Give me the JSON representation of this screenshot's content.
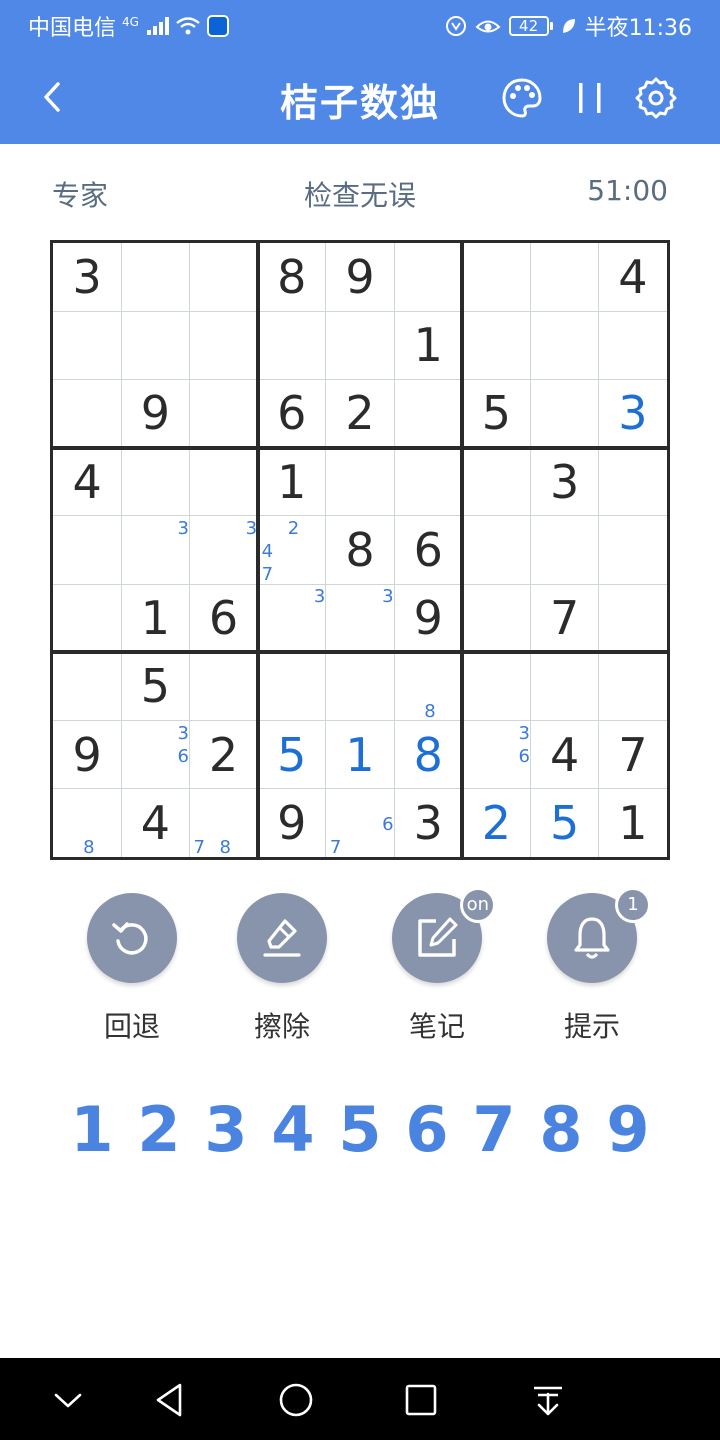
{
  "status_bar": {
    "carrier": "中国电信",
    "network": "4G",
    "battery": "42",
    "time": "半夜11:36"
  },
  "app_bar": {
    "title": "桔子数独",
    "icons": [
      "back-arrow-icon",
      "palette-icon",
      "pause-icon",
      "gear-icon"
    ]
  },
  "info": {
    "difficulty": "专家",
    "check_status": "检查无误",
    "timer": "51:00"
  },
  "board": {
    "cells": [
      {
        "r": 0,
        "c": 0,
        "v": "3",
        "t": "given"
      },
      {
        "r": 0,
        "c": 3,
        "v": "8",
        "t": "given"
      },
      {
        "r": 0,
        "c": 4,
        "v": "9",
        "t": "given"
      },
      {
        "r": 0,
        "c": 8,
        "v": "4",
        "t": "given"
      },
      {
        "r": 1,
        "c": 5,
        "v": "1",
        "t": "given"
      },
      {
        "r": 2,
        "c": 1,
        "v": "9",
        "t": "given"
      },
      {
        "r": 2,
        "c": 3,
        "v": "6",
        "t": "given"
      },
      {
        "r": 2,
        "c": 4,
        "v": "2",
        "t": "given"
      },
      {
        "r": 2,
        "c": 6,
        "v": "5",
        "t": "given"
      },
      {
        "r": 2,
        "c": 8,
        "v": "3",
        "t": "user"
      },
      {
        "r": 3,
        "c": 0,
        "v": "4",
        "t": "given"
      },
      {
        "r": 3,
        "c": 3,
        "v": "1",
        "t": "given"
      },
      {
        "r": 3,
        "c": 7,
        "v": "3",
        "t": "given"
      },
      {
        "r": 4,
        "c": 4,
        "v": "8",
        "t": "given"
      },
      {
        "r": 4,
        "c": 5,
        "v": "6",
        "t": "given"
      },
      {
        "r": 5,
        "c": 1,
        "v": "1",
        "t": "given"
      },
      {
        "r": 5,
        "c": 2,
        "v": "6",
        "t": "given"
      },
      {
        "r": 5,
        "c": 5,
        "v": "9",
        "t": "given"
      },
      {
        "r": 5,
        "c": 7,
        "v": "7",
        "t": "given"
      },
      {
        "r": 6,
        "c": 1,
        "v": "5",
        "t": "given"
      },
      {
        "r": 7,
        "c": 0,
        "v": "9",
        "t": "given"
      },
      {
        "r": 7,
        "c": 2,
        "v": "2",
        "t": "given"
      },
      {
        "r": 7,
        "c": 3,
        "v": "5",
        "t": "user"
      },
      {
        "r": 7,
        "c": 4,
        "v": "1",
        "t": "user"
      },
      {
        "r": 7,
        "c": 5,
        "v": "8",
        "t": "user"
      },
      {
        "r": 7,
        "c": 7,
        "v": "4",
        "t": "given"
      },
      {
        "r": 7,
        "c": 8,
        "v": "7",
        "t": "given"
      },
      {
        "r": 8,
        "c": 1,
        "v": "4",
        "t": "given"
      },
      {
        "r": 8,
        "c": 3,
        "v": "9",
        "t": "given"
      },
      {
        "r": 8,
        "c": 5,
        "v": "3",
        "t": "given"
      },
      {
        "r": 8,
        "c": 6,
        "v": "2",
        "t": "user"
      },
      {
        "r": 8,
        "c": 7,
        "v": "5",
        "t": "user"
      },
      {
        "r": 8,
        "c": 8,
        "v": "1",
        "t": "given"
      }
    ],
    "notes": [
      {
        "r": 4,
        "c": 1,
        "v": [
          "3"
        ]
      },
      {
        "r": 4,
        "c": 2,
        "v": [
          "3"
        ]
      },
      {
        "r": 4,
        "c": 3,
        "v": [
          "2",
          "4",
          "7"
        ]
      },
      {
        "r": 5,
        "c": 3,
        "v": [
          "3"
        ]
      },
      {
        "r": 5,
        "c": 4,
        "v": [
          "3"
        ]
      },
      {
        "r": 6,
        "c": 5,
        "v": [
          "8"
        ]
      },
      {
        "r": 7,
        "c": 1,
        "v": [
          "3",
          "6"
        ]
      },
      {
        "r": 7,
        "c": 6,
        "v": [
          "3",
          "6"
        ]
      },
      {
        "r": 8,
        "c": 0,
        "v": [
          "8"
        ]
      },
      {
        "r": 8,
        "c": 2,
        "v": [
          "7",
          "8"
        ]
      },
      {
        "r": 8,
        "c": 4,
        "v": [
          "7",
          "6"
        ]
      }
    ]
  },
  "tools": {
    "undo": {
      "label": "回退",
      "icon": "undo-icon"
    },
    "erase": {
      "label": "擦除",
      "icon": "eraser-icon"
    },
    "notes": {
      "label": "笔记",
      "icon": "edit-note-icon",
      "badge": "on"
    },
    "hint": {
      "label": "提示",
      "icon": "bell-icon",
      "badge": "1"
    }
  },
  "numpad": [
    "1",
    "2",
    "3",
    "4",
    "5",
    "6",
    "7",
    "8",
    "9"
  ],
  "colors": {
    "primary": "#4f88e6",
    "tool_button": "#8894ab",
    "user_digit": "#1d6fd6",
    "note_digit": "#3a7ad9",
    "numpad_digit": "#4a84e0"
  }
}
